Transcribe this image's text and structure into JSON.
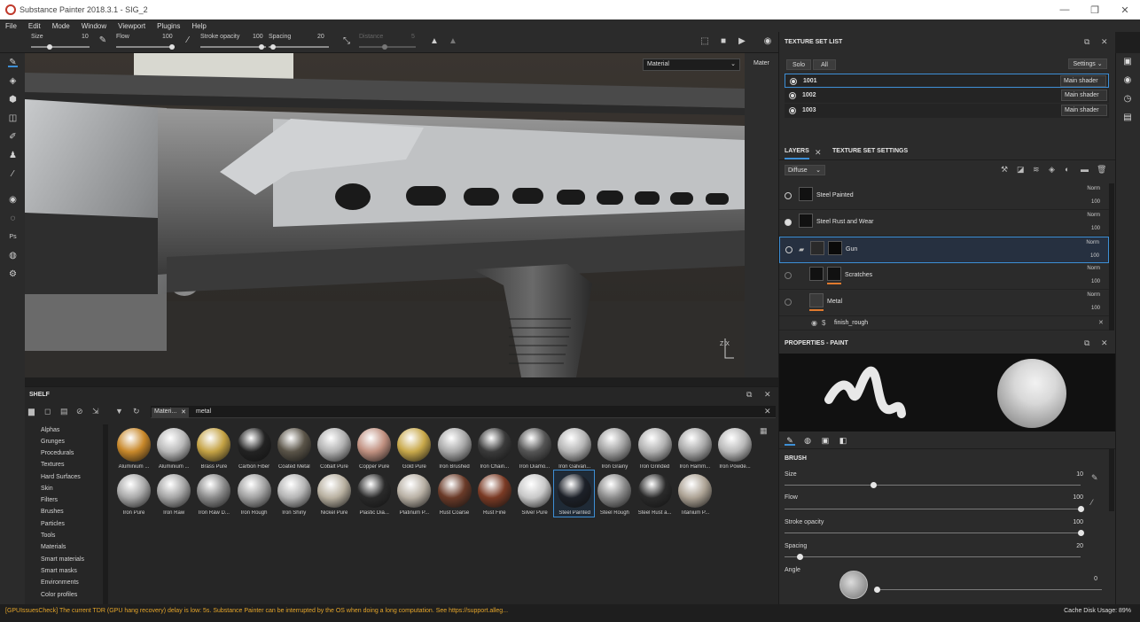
{
  "window": {
    "title": "Substance Painter 2018.3.1 - SIG_2",
    "minimize": "—",
    "maximize": "❐",
    "close": "✕"
  },
  "menu": [
    "File",
    "Edit",
    "Mode",
    "Window",
    "Viewport",
    "Plugins",
    "Help"
  ],
  "tool_options": {
    "size_label": "Size",
    "size_value": "10",
    "flow_label": "Flow",
    "flow_value": "100",
    "stroke_label": "Stroke opacity",
    "stroke_value": "100",
    "spacing_label": "Spacing",
    "spacing_value": "20",
    "distance_label": "Distance",
    "distance_value": "5"
  },
  "viewport": {
    "mode_dropdown": "Material",
    "uv_label": "Mater",
    "axis_3d": "Z X",
    "axis_uv": "U"
  },
  "shelf": {
    "title": "SHELF",
    "filter_tag": "Materi...",
    "search_query": "metal",
    "categories": [
      "Alphas",
      "Grunges",
      "Procedurals",
      "Textures",
      "Hard Surfaces",
      "Skin",
      "Filters",
      "Brushes",
      "Particles",
      "Tools",
      "Materials",
      "Smart materials",
      "Smart masks",
      "Environments",
      "Color profiles"
    ],
    "materials_row1": [
      {
        "name": "Aluminium ...",
        "color": "#c8882a"
      },
      {
        "name": "Aluminium ...",
        "color": "#b8b8b8"
      },
      {
        "name": "Brass Pure",
        "color": "#c4a244"
      },
      {
        "name": "Carbon Fiber",
        "color": "#222222"
      },
      {
        "name": "Coated Metal",
        "color": "#5a5448"
      },
      {
        "name": "Cobalt Pure",
        "color": "#b0b0b0"
      },
      {
        "name": "Copper Pure",
        "color": "#c09080"
      },
      {
        "name": "Gold Pure",
        "color": "#c8a84a"
      },
      {
        "name": "Iron Brushed",
        "color": "#a8a8a8"
      },
      {
        "name": "Iron Chain...",
        "color": "#3a3a3a"
      },
      {
        "name": "Iron Diamo...",
        "color": "#555555"
      },
      {
        "name": "Iron Galvan...",
        "color": "#b4b4b4"
      },
      {
        "name": "Iron Grainy",
        "color": "#a0a0a0"
      },
      {
        "name": "Iron Grinded",
        "color": "#b0b0b0"
      },
      {
        "name": "Iron Hamm...",
        "color": "#a8a8a8"
      },
      {
        "name": "Iron Powde...",
        "color": "#b8b8b8"
      }
    ],
    "materials_row2": [
      {
        "name": "Iron Pure",
        "color": "#a8a8a8"
      },
      {
        "name": "Iron Raw",
        "color": "#a4a4a4"
      },
      {
        "name": "Iron Raw D...",
        "color": "#8a8a8a"
      },
      {
        "name": "Iron Rough",
        "color": "#a0a0a0"
      },
      {
        "name": "Iron Shiny",
        "color": "#b4b4b4"
      },
      {
        "name": "Nickel Pure",
        "color": "#b8b0a0"
      },
      {
        "name": "Plastic Dia...",
        "color": "#2a2a2a"
      },
      {
        "name": "Platinum P...",
        "color": "#b8b0a4"
      },
      {
        "name": "Rust Coarse",
        "color": "#6a3a28"
      },
      {
        "name": "Rust Fine",
        "color": "#7a3a24"
      },
      {
        "name": "Silver Pure",
        "color": "#c8c8c8"
      },
      {
        "name": "Steel Painted",
        "color": "#1c2028"
      },
      {
        "name": "Steel Rough",
        "color": "#8a8a8a"
      },
      {
        "name": "Steel Rust a...",
        "color": "#2a2a2a"
      },
      {
        "name": "Titanium P...",
        "color": "#aca294"
      }
    ]
  },
  "texture_set_list": {
    "title": "TEXTURE SET LIST",
    "solo": "Solo",
    "all": "All",
    "settings": "Settings",
    "rows": [
      {
        "name": "1001",
        "shader": "Main shader"
      },
      {
        "name": "1002",
        "shader": "Main shader"
      },
      {
        "name": "1003",
        "shader": "Main shader"
      }
    ]
  },
  "layers": {
    "tab_layers": "LAYERS",
    "tab_settings": "TEXTURE SET SETTINGS",
    "channel": "Diffuse",
    "items": [
      {
        "name": "Steel Painted",
        "blend": "Norm",
        "opacity": "100"
      },
      {
        "name": "Steel Rust and Wear",
        "blend": "Norm",
        "opacity": "100"
      },
      {
        "name": "Gun",
        "blend": "Norm",
        "opacity": "100"
      },
      {
        "name": "Scratches",
        "blend": "Norm",
        "opacity": "100"
      },
      {
        "name": "Metal",
        "blend": "Norm",
        "opacity": "100"
      }
    ],
    "effect": "finish_rough"
  },
  "properties": {
    "title": "PROPERTIES - PAINT",
    "section": "BRUSH",
    "size_label": "Size",
    "size_value": "10",
    "size_level": 0.3,
    "flow_label": "Flow",
    "flow_value": "100",
    "flow_level": 1.0,
    "stroke_label": "Stroke opacity",
    "stroke_value": "100",
    "stroke_level": 1.0,
    "spacing_label": "Spacing",
    "spacing_value": "20",
    "spacing_level": 0.05,
    "angle_label": "Angle",
    "angle_value": "0"
  },
  "status": {
    "message": "[GPUIssuesCheck] The current TDR (GPU hang recovery) delay is low: 5s. Substance Painter can be interrupted by the OS when doing a long computation. See https://support.alleg...",
    "cache": "Cache Disk Usage:   89%"
  },
  "colors": {
    "accent": "#3d8fd6",
    "warning": "#e5a52a",
    "paint_bar": "#e07a2e"
  }
}
